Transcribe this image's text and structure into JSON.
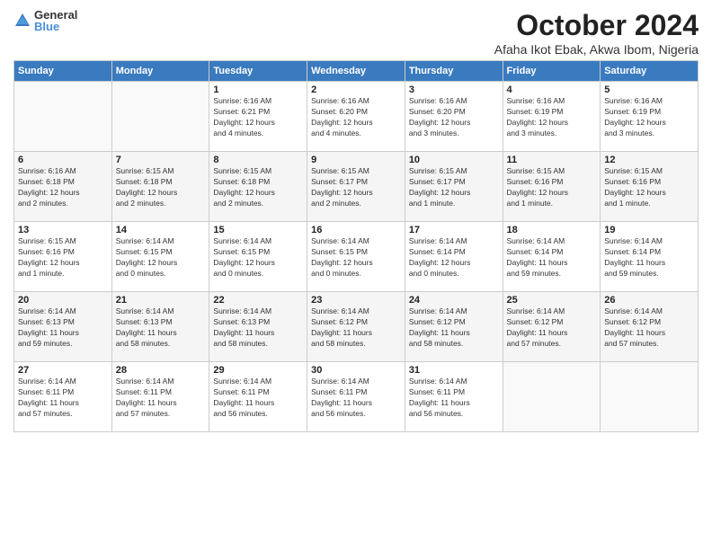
{
  "logo": {
    "general": "General",
    "blue": "Blue"
  },
  "header": {
    "month": "October 2024",
    "location": "Afaha Ikot Ebak, Akwa Ibom, Nigeria"
  },
  "weekdays": [
    "Sunday",
    "Monday",
    "Tuesday",
    "Wednesday",
    "Thursday",
    "Friday",
    "Saturday"
  ],
  "weeks": [
    [
      {
        "day": "",
        "info": ""
      },
      {
        "day": "",
        "info": ""
      },
      {
        "day": "1",
        "info": "Sunrise: 6:16 AM\nSunset: 6:21 PM\nDaylight: 12 hours\nand 4 minutes."
      },
      {
        "day": "2",
        "info": "Sunrise: 6:16 AM\nSunset: 6:20 PM\nDaylight: 12 hours\nand 4 minutes."
      },
      {
        "day": "3",
        "info": "Sunrise: 6:16 AM\nSunset: 6:20 PM\nDaylight: 12 hours\nand 3 minutes."
      },
      {
        "day": "4",
        "info": "Sunrise: 6:16 AM\nSunset: 6:19 PM\nDaylight: 12 hours\nand 3 minutes."
      },
      {
        "day": "5",
        "info": "Sunrise: 6:16 AM\nSunset: 6:19 PM\nDaylight: 12 hours\nand 3 minutes."
      }
    ],
    [
      {
        "day": "6",
        "info": "Sunrise: 6:16 AM\nSunset: 6:18 PM\nDaylight: 12 hours\nand 2 minutes."
      },
      {
        "day": "7",
        "info": "Sunrise: 6:15 AM\nSunset: 6:18 PM\nDaylight: 12 hours\nand 2 minutes."
      },
      {
        "day": "8",
        "info": "Sunrise: 6:15 AM\nSunset: 6:18 PM\nDaylight: 12 hours\nand 2 minutes."
      },
      {
        "day": "9",
        "info": "Sunrise: 6:15 AM\nSunset: 6:17 PM\nDaylight: 12 hours\nand 2 minutes."
      },
      {
        "day": "10",
        "info": "Sunrise: 6:15 AM\nSunset: 6:17 PM\nDaylight: 12 hours\nand 1 minute."
      },
      {
        "day": "11",
        "info": "Sunrise: 6:15 AM\nSunset: 6:16 PM\nDaylight: 12 hours\nand 1 minute."
      },
      {
        "day": "12",
        "info": "Sunrise: 6:15 AM\nSunset: 6:16 PM\nDaylight: 12 hours\nand 1 minute."
      }
    ],
    [
      {
        "day": "13",
        "info": "Sunrise: 6:15 AM\nSunset: 6:16 PM\nDaylight: 12 hours\nand 1 minute."
      },
      {
        "day": "14",
        "info": "Sunrise: 6:14 AM\nSunset: 6:15 PM\nDaylight: 12 hours\nand 0 minutes."
      },
      {
        "day": "15",
        "info": "Sunrise: 6:14 AM\nSunset: 6:15 PM\nDaylight: 12 hours\nand 0 minutes."
      },
      {
        "day": "16",
        "info": "Sunrise: 6:14 AM\nSunset: 6:15 PM\nDaylight: 12 hours\nand 0 minutes."
      },
      {
        "day": "17",
        "info": "Sunrise: 6:14 AM\nSunset: 6:14 PM\nDaylight: 12 hours\nand 0 minutes."
      },
      {
        "day": "18",
        "info": "Sunrise: 6:14 AM\nSunset: 6:14 PM\nDaylight: 11 hours\nand 59 minutes."
      },
      {
        "day": "19",
        "info": "Sunrise: 6:14 AM\nSunset: 6:14 PM\nDaylight: 11 hours\nand 59 minutes."
      }
    ],
    [
      {
        "day": "20",
        "info": "Sunrise: 6:14 AM\nSunset: 6:13 PM\nDaylight: 11 hours\nand 59 minutes."
      },
      {
        "day": "21",
        "info": "Sunrise: 6:14 AM\nSunset: 6:13 PM\nDaylight: 11 hours\nand 58 minutes."
      },
      {
        "day": "22",
        "info": "Sunrise: 6:14 AM\nSunset: 6:13 PM\nDaylight: 11 hours\nand 58 minutes."
      },
      {
        "day": "23",
        "info": "Sunrise: 6:14 AM\nSunset: 6:12 PM\nDaylight: 11 hours\nand 58 minutes."
      },
      {
        "day": "24",
        "info": "Sunrise: 6:14 AM\nSunset: 6:12 PM\nDaylight: 11 hours\nand 58 minutes."
      },
      {
        "day": "25",
        "info": "Sunrise: 6:14 AM\nSunset: 6:12 PM\nDaylight: 11 hours\nand 57 minutes."
      },
      {
        "day": "26",
        "info": "Sunrise: 6:14 AM\nSunset: 6:12 PM\nDaylight: 11 hours\nand 57 minutes."
      }
    ],
    [
      {
        "day": "27",
        "info": "Sunrise: 6:14 AM\nSunset: 6:11 PM\nDaylight: 11 hours\nand 57 minutes."
      },
      {
        "day": "28",
        "info": "Sunrise: 6:14 AM\nSunset: 6:11 PM\nDaylight: 11 hours\nand 57 minutes."
      },
      {
        "day": "29",
        "info": "Sunrise: 6:14 AM\nSunset: 6:11 PM\nDaylight: 11 hours\nand 56 minutes."
      },
      {
        "day": "30",
        "info": "Sunrise: 6:14 AM\nSunset: 6:11 PM\nDaylight: 11 hours\nand 56 minutes."
      },
      {
        "day": "31",
        "info": "Sunrise: 6:14 AM\nSunset: 6:11 PM\nDaylight: 11 hours\nand 56 minutes."
      },
      {
        "day": "",
        "info": ""
      },
      {
        "day": "",
        "info": ""
      }
    ]
  ]
}
